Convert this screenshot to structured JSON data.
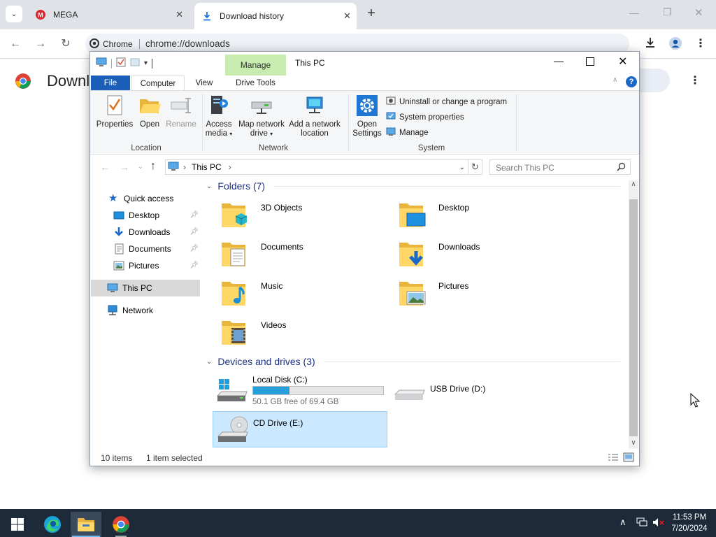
{
  "browser": {
    "tabs": [
      {
        "label": "MEGA",
        "icon": "mega-icon",
        "active": false
      },
      {
        "label": "Download history",
        "icon": "download-icon",
        "active": true
      }
    ],
    "omnibox_chip": "Chrome",
    "url": "chrome://downloads",
    "page_title": "Downl"
  },
  "explorer": {
    "title": "This PC",
    "context_tab": "Manage",
    "ribbon_tabs": [
      "File",
      "Computer",
      "View",
      "Drive Tools"
    ],
    "location_group": {
      "label": "Location",
      "buttons": [
        "Properties",
        "Open",
        "Rename"
      ]
    },
    "network_group": {
      "label": "Network",
      "access_media": [
        "Access",
        "media"
      ],
      "map_drive": [
        "Map network",
        "drive"
      ],
      "add_location": [
        "Add a network",
        "location"
      ]
    },
    "system_group": {
      "label": "System",
      "open_settings": [
        "Open",
        "Settings"
      ],
      "links": [
        "Uninstall or change a program",
        "System properties",
        "Manage"
      ]
    },
    "address": "This PC",
    "search_placeholder": "Search This PC",
    "nav": {
      "quick_access": "Quick access",
      "pinned": [
        "Desktop",
        "Downloads",
        "Documents",
        "Pictures"
      ],
      "this_pc": "This PC",
      "network": "Network"
    },
    "folders_header": "Folders (7)",
    "folders": [
      "3D Objects",
      "Desktop",
      "Documents",
      "Downloads",
      "Music",
      "Pictures",
      "Videos"
    ],
    "devices_header": "Devices and drives (3)",
    "drives": {
      "c": {
        "name": "Local Disk (C:)",
        "free": "50.1 GB free of 69.4 GB",
        "used_fraction": 0.28
      },
      "d": {
        "name": "USB Drive (D:)"
      },
      "e": {
        "name": "CD Drive (E:)"
      }
    },
    "status": {
      "items": "10 items",
      "selected": "1 item selected"
    }
  },
  "taskbar": {
    "time": "11:53 PM",
    "date": "7/20/2024"
  },
  "colors": {
    "chrome_tabstrip": "#dfe3e8",
    "file_tab": "#1b5fb8",
    "manage_tab": "#c8ecb0",
    "selection": "#cce8ff",
    "selection_border": "#99d1ff",
    "drive_bar": "#26a0da",
    "taskbar": "#1c2a3a",
    "section_header": "#1e3287"
  }
}
